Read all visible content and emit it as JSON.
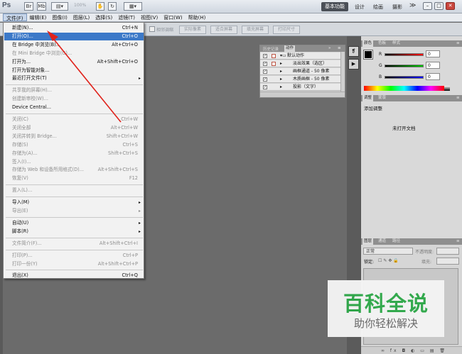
{
  "app": {
    "logo": "Ps",
    "zoom": "100%"
  },
  "workspace": {
    "basic": "基本功能",
    "design": "设计",
    "painting": "绘画",
    "photography": "摄影",
    "more": "≫"
  },
  "menubar": [
    "文件(F)",
    "编辑(E)",
    "图像(I)",
    "图层(L)",
    "选择(S)",
    "滤镜(T)",
    "视图(V)",
    "窗口(W)",
    "帮助(H)"
  ],
  "options": {
    "check_label": "相邻调缩",
    "buttons": [
      "实际像素",
      "适合屏幕",
      "填充屏幕",
      "打印尺寸"
    ]
  },
  "file_menu": [
    {
      "label": "新建(N)...",
      "shortcut": "Ctrl+N",
      "state": "normal"
    },
    {
      "label": "打开(O)...",
      "shortcut": "Ctrl+O",
      "state": "selected"
    },
    {
      "label": "在 Bridge 中浏览(B)...",
      "shortcut": "Alt+Ctrl+O",
      "state": "normal"
    },
    {
      "label": "在 Mini Bridge 中浏览(G)...",
      "shortcut": "",
      "state": "disabled"
    },
    {
      "label": "打开为...",
      "shortcut": "Alt+Shift+Ctrl+O",
      "state": "normal"
    },
    {
      "label": "打开为智能对象...",
      "shortcut": "",
      "state": "normal"
    },
    {
      "label": "最近打开文件(T)",
      "shortcut": "",
      "state": "normal",
      "submenu": true
    },
    {
      "sep": true
    },
    {
      "label": "共享我的屏幕(H)...",
      "shortcut": "",
      "state": "disabled"
    },
    {
      "label": "创建新审校(W)...",
      "shortcut": "",
      "state": "disabled"
    },
    {
      "label": "Device Central...",
      "shortcut": "",
      "state": "normal"
    },
    {
      "sep": true
    },
    {
      "label": "关闭(C)",
      "shortcut": "Ctrl+W",
      "state": "disabled"
    },
    {
      "label": "关闭全部",
      "shortcut": "Alt+Ctrl+W",
      "state": "disabled"
    },
    {
      "label": "关闭并转到 Bridge...",
      "shortcut": "Shift+Ctrl+W",
      "state": "disabled"
    },
    {
      "label": "存储(S)",
      "shortcut": "Ctrl+S",
      "state": "disabled"
    },
    {
      "label": "存储为(A)...",
      "shortcut": "Shift+Ctrl+S",
      "state": "disabled"
    },
    {
      "label": "签入(I)...",
      "shortcut": "",
      "state": "disabled"
    },
    {
      "label": "存储为 Web 和设备所用格式(D)...",
      "shortcut": "Alt+Shift+Ctrl+S",
      "state": "disabled"
    },
    {
      "label": "恢复(V)",
      "shortcut": "F12",
      "state": "disabled"
    },
    {
      "sep": true
    },
    {
      "label": "置入(L)...",
      "shortcut": "",
      "state": "disabled"
    },
    {
      "sep": true
    },
    {
      "label": "导入(M)",
      "shortcut": "",
      "state": "normal",
      "submenu": true
    },
    {
      "label": "导出(E)",
      "shortcut": "",
      "state": "disabled",
      "submenu": true
    },
    {
      "sep": true
    },
    {
      "label": "自动(U)",
      "shortcut": "",
      "state": "normal",
      "submenu": true
    },
    {
      "label": "脚本(R)",
      "shortcut": "",
      "state": "normal",
      "submenu": true
    },
    {
      "sep": true
    },
    {
      "label": "文件简介(F)...",
      "shortcut": "Alt+Shift+Ctrl+I",
      "state": "disabled"
    },
    {
      "sep": true
    },
    {
      "label": "打印(P)...",
      "shortcut": "Ctrl+P",
      "state": "disabled"
    },
    {
      "label": "打印一份(Y)",
      "shortcut": "Alt+Shift+Ctrl+P",
      "state": "disabled"
    },
    {
      "sep": true
    },
    {
      "label": "退出(X)",
      "shortcut": "Ctrl+Q",
      "state": "normal"
    }
  ],
  "actions_panel": {
    "tab_history": "历史记录",
    "tab_actions": "动作",
    "rows": [
      "默认动作",
      "淡出效果（选区）",
      "画框通道 - 50 像素",
      "木质画框 - 50 像素",
      "投影（文字）"
    ]
  },
  "color_panel": {
    "tabs": [
      "颜色",
      "色板",
      "样式"
    ],
    "labels": [
      "R",
      "G",
      "B"
    ],
    "values": [
      "0",
      "0",
      "0"
    ]
  },
  "adjust_panel": {
    "tabs": [
      "调整",
      "蒙版"
    ],
    "title": "添加调整",
    "no_doc": "未打开文档"
  },
  "layers_panel": {
    "tabs": [
      "图层",
      "通道",
      "路径"
    ],
    "blend": "正常",
    "opacity_label": "不透明度:",
    "lock_label": "锁定:",
    "fill_label": "填充:"
  },
  "watermark": {
    "main": "百科全说",
    "sub": "助你轻松解决"
  }
}
